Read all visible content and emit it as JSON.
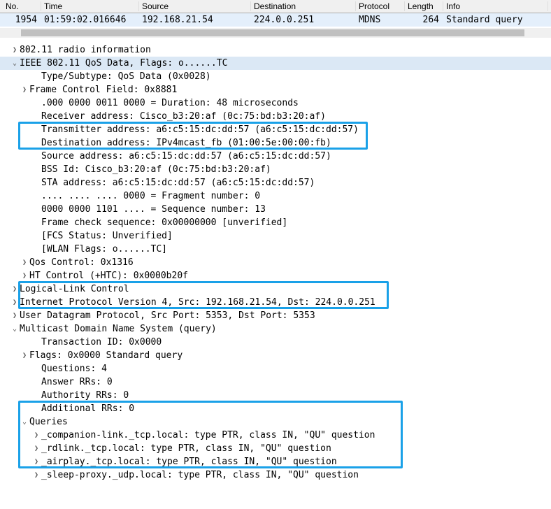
{
  "columns": [
    "No.",
    "Time",
    "Source",
    "Destination",
    "Protocol",
    "Length",
    "Info"
  ],
  "packet": {
    "no": "1954",
    "time": "01:59:02.016646",
    "source": "192.168.21.54",
    "destination": "224.0.0.251",
    "protocol": "MDNS",
    "length": "264",
    "info": "Standard query"
  },
  "tree": {
    "radio_info": "802.11 radio information",
    "ieee80211": "IEEE 802.11 QoS Data, Flags: o......TC",
    "type_subtype": "Type/Subtype: QoS Data (0x0028)",
    "frame_ctl": "Frame Control Field: 0x8881",
    "duration": ".000 0000 0011 0000 = Duration: 48 microseconds",
    "receiver": "Receiver address: Cisco_b3:20:af (0c:75:bd:b3:20:af)",
    "transmitter": "Transmitter address: a6:c5:15:dc:dd:57 (a6:c5:15:dc:dd:57)",
    "dest_addr": "Destination address: IPv4mcast_fb (01:00:5e:00:00:fb)",
    "src_addr": "Source address: a6:c5:15:dc:dd:57 (a6:c5:15:dc:dd:57)",
    "bssid": "BSS Id: Cisco_b3:20:af (0c:75:bd:b3:20:af)",
    "sta_addr": "STA address: a6:c5:15:dc:dd:57 (a6:c5:15:dc:dd:57)",
    "frag_no": ".... .... .... 0000 = Fragment number: 0",
    "seq_no": "0000 0000 1101 .... = Sequence number: 13",
    "fcs": "Frame check sequence: 0x00000000 [unverified]",
    "fcs_status": "[FCS Status: Unverified]",
    "wlan_flags": "[WLAN Flags: o......TC]",
    "qos_ctl": "Qos Control: 0x1316",
    "ht_ctl": "HT Control (+HTC): 0x0000b20f",
    "llc": "Logical-Link Control",
    "ip": "Internet Protocol Version 4, Src: 192.168.21.54, Dst: 224.0.0.251",
    "udp": "User Datagram Protocol, Src Port: 5353, Dst Port: 5353",
    "mdns": "Multicast Domain Name System (query)",
    "txid": "Transaction ID: 0x0000",
    "flags": "Flags: 0x0000 Standard query",
    "questions": "Questions: 4",
    "answer_rrs": "Answer RRs: 0",
    "authority_rrs": "Authority RRs: 0",
    "additional_rrs": "Additional RRs: 0",
    "queries_label": "Queries",
    "queries": {
      "q0": "_companion-link._tcp.local: type PTR, class IN, \"QU\" question",
      "q1": "_rdlink._tcp.local: type PTR, class IN, \"QU\" question",
      "q2": "_airplay._tcp.local: type PTR, class IN, \"QU\" question",
      "q3": "_sleep-proxy._udp.local: type PTR, class IN, \"QU\" question"
    }
  }
}
